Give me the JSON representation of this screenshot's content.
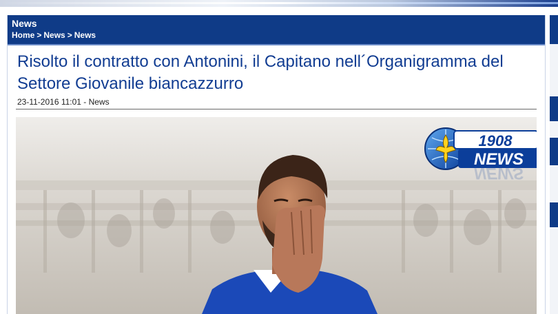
{
  "section": {
    "title": "News"
  },
  "breadcrumb": {
    "items": [
      "Home",
      "News",
      "News"
    ],
    "separator": ">"
  },
  "article": {
    "headline": "Risolto il contratto con Antonini, il Capitano nell´Organigramma del Settore Giovanile biancazzurro",
    "meta": "23-11-2016 11:01 - News"
  },
  "logo": {
    "top_text": "1908",
    "bottom_text": "NEWS"
  },
  "colors": {
    "header_bg": "#0f3b87",
    "headline": "#123d92",
    "jersey": "#1b49b8"
  }
}
